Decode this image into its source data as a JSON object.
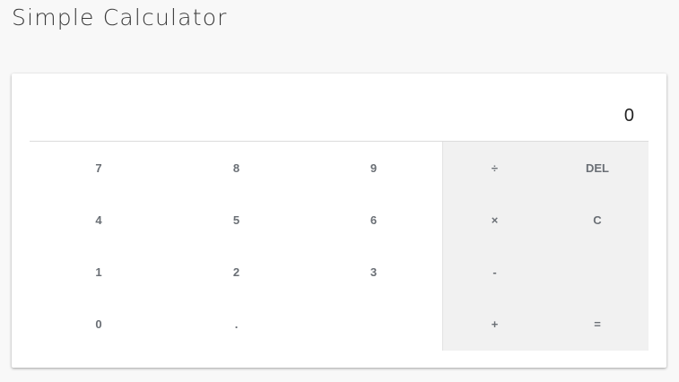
{
  "page": {
    "title": "Simple Calculator"
  },
  "display": {
    "value": "0"
  },
  "number_keys": [
    [
      "7",
      "8",
      "9"
    ],
    [
      "4",
      "5",
      "6"
    ],
    [
      "1",
      "2",
      "3"
    ],
    [
      "0",
      ".",
      ""
    ]
  ],
  "operator_keys": [
    [
      "÷",
      "DEL"
    ],
    [
      "×",
      "C"
    ],
    [
      "-",
      ""
    ],
    [
      "+",
      "="
    ]
  ],
  "colors": {
    "background": "#f8f8f8",
    "card": "#ffffff",
    "operator_panel": "#f1f1f1",
    "key_text": "#6a6f75"
  }
}
